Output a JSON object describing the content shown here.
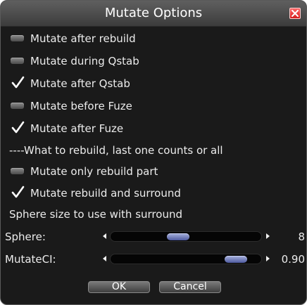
{
  "dialog": {
    "title": "Mutate Options",
    "close_icon": "close-icon"
  },
  "options": [
    {
      "label": "Mutate after rebuild",
      "checked": false
    },
    {
      "label": "Mutate during Qstab",
      "checked": false
    },
    {
      "label": "Mutate after Qstab",
      "checked": true
    },
    {
      "label": "Mutate before Fuze",
      "checked": false
    },
    {
      "label": "Mutate after Fuze",
      "checked": true
    }
  ],
  "rebuild_heading": "----What to rebuild, last one counts or all",
  "rebuild_options": [
    {
      "label": "Mutate only rebuild part",
      "checked": false
    },
    {
      "label": "Mutate rebuild and surround",
      "checked": true
    }
  ],
  "sphere_heading": "Sphere size to use with surround",
  "sliders": [
    {
      "label": "Sphere:",
      "value": "8",
      "position": 0.44
    },
    {
      "label": "MutateCI:",
      "value": "0.90",
      "position": 0.9
    }
  ],
  "buttons": {
    "ok": "OK",
    "cancel": "Cancel"
  },
  "colors": {
    "background": "#1a1a1a",
    "title_bar": "#4a4a4a",
    "slider_thumb": "#7b86c2",
    "close_button": "#e03030"
  }
}
